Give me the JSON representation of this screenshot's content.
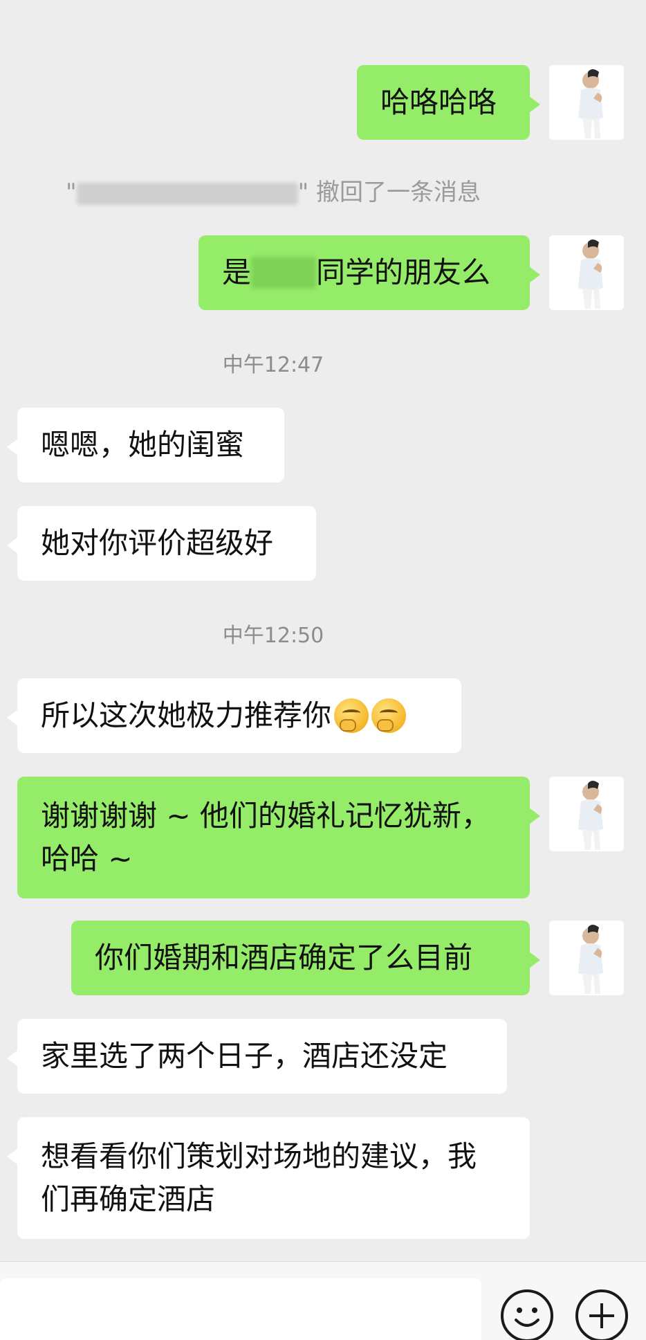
{
  "chat": {
    "messages": [
      {
        "side": "out",
        "text": "哈咯哈咯"
      },
      {
        "text": "撤回了一条消息"
      },
      {
        "side": "out",
        "prefix": "是",
        "suffix": "同学的朋友么"
      },
      {
        "text": "中午12:47"
      },
      {
        "side": "in",
        "text": "嗯嗯，她的闺蜜"
      },
      {
        "side": "in",
        "text": "她对你评价超级好"
      },
      {
        "text": "中午12:50"
      },
      {
        "side": "in",
        "text": "所以这次她极力推荐你",
        "emoji": "thinking-face-icon"
      },
      {
        "side": "out",
        "text": "谢谢谢谢 ~ 他们的婚礼记忆犹新，\n哈哈 ~"
      },
      {
        "side": "out",
        "text": "你们婚期和酒店确定了么目前"
      },
      {
        "side": "in",
        "text": "家里选了两个日子，酒店还没定"
      },
      {
        "side": "in",
        "text": "想看看你们策划对场地的建议，我\n们再确定酒店"
      }
    ]
  },
  "input_bar": {
    "emoji_button_icon": "smiley-icon",
    "more_button_icon": "plus-icon"
  },
  "colors": {
    "background": "#ededed",
    "outgoing_bubble": "#95ec69",
    "incoming_bubble": "#ffffff",
    "timestamp_text": "#8c8c8c"
  }
}
